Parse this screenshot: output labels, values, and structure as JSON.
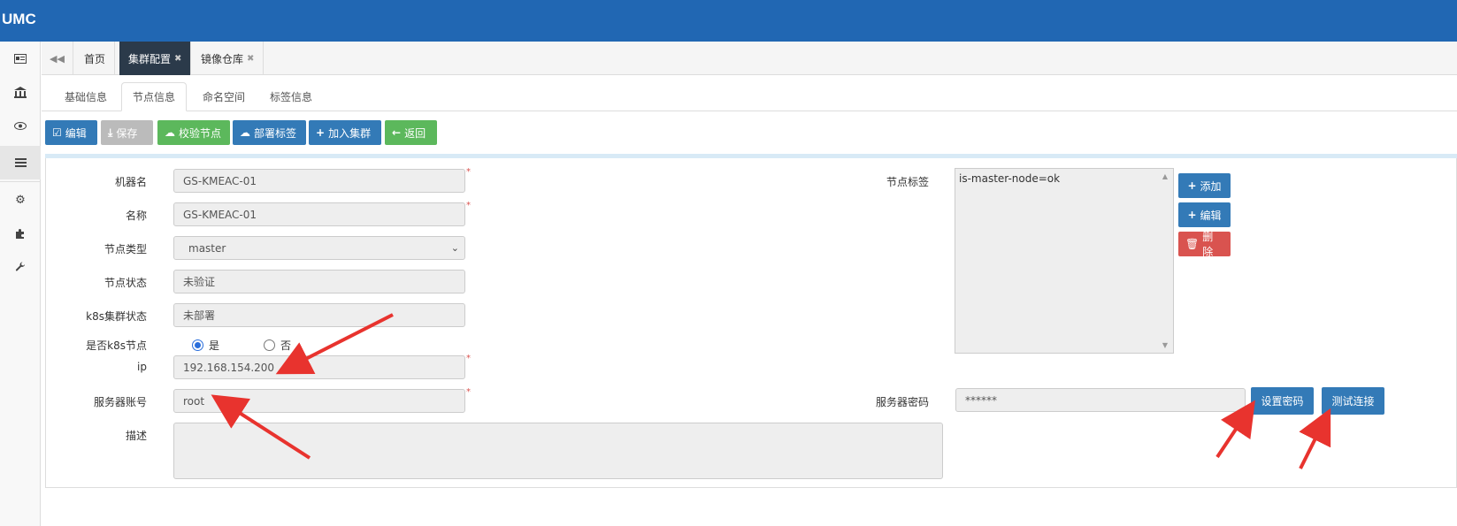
{
  "app": {
    "title": "UMC"
  },
  "sidebar": {
    "icons": [
      "id-card-icon",
      "bank-icon",
      "eye-icon",
      "list-icon",
      "gear-icon",
      "puzzle-icon",
      "wrench-icon"
    ]
  },
  "tabs": [
    {
      "label": "首页"
    },
    {
      "label": "集群配置"
    },
    {
      "label": "镜像仓库"
    }
  ],
  "subtabs": [
    {
      "label": "基础信息"
    },
    {
      "label": "节点信息"
    },
    {
      "label": "命名空间"
    },
    {
      "label": "标签信息"
    }
  ],
  "toolbar": {
    "edit": "编辑",
    "save": "保存",
    "verify": "校验节点",
    "deploy_label": "部署标签",
    "join": "加入集群",
    "back": "返回"
  },
  "form": {
    "machine_name": {
      "label": "机器名",
      "value": "GS-KMEAC-01"
    },
    "name": {
      "label": "名称",
      "value": "GS-KMEAC-01"
    },
    "node_type": {
      "label": "节点类型",
      "value": "master"
    },
    "node_status": {
      "label": "节点状态",
      "value": "未验证"
    },
    "k8s_status": {
      "label": "k8s集群状态",
      "value": "未部署"
    },
    "is_k8s_node": {
      "label": "是否k8s节点",
      "yes": "是",
      "no": "否",
      "selected": "是"
    },
    "ip": {
      "label": "ip",
      "value": "192.168.154.200"
    },
    "server_account": {
      "label": "服务器账号",
      "value": "root"
    },
    "description": {
      "label": "描述",
      "value": ""
    },
    "node_labels": {
      "label": "节点标签",
      "items": [
        "is-master-node=ok"
      ]
    },
    "server_password": {
      "label": "服务器密码",
      "value": "******"
    }
  },
  "label_actions": {
    "add": "添加",
    "edit": "编辑",
    "delete": "删除"
  },
  "password_actions": {
    "set": "设置密码",
    "test": "测试连接"
  },
  "required_mark": "*",
  "colors": {
    "topbar": "#2167b3",
    "primary": "#337ab7",
    "success": "#5cb85c",
    "danger": "#d9534f",
    "arrow": "#e8332e"
  }
}
